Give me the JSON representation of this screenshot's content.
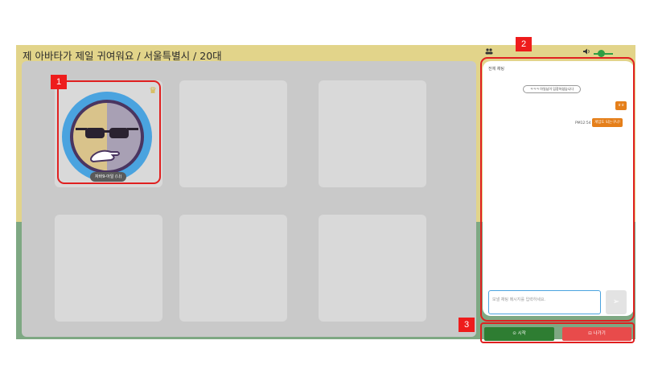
{
  "header": {
    "title": "제 아바타가 제일 귀여워요 / 서울특별시 / 20대",
    "people_icon": "people-icon",
    "volume_icon": "volume-icon"
  },
  "player": {
    "nametag": "자바9-아일 (나)",
    "crown_icon": "crown-icon"
  },
  "annotations": {
    "badge1": "1",
    "badge2": "2",
    "badge3": "3"
  },
  "chat": {
    "header": "전체 채팅",
    "system_message": "ㅋㅋㅋ 아일님이 입장하셨습니다",
    "messages": [
      {
        "text": "ㅎㅎ"
      },
      {
        "text": "게임도 되는구나!",
        "time": "PM12:54"
      }
    ],
    "input_placeholder": "보낼 채팅 메시지를 입력하세요.",
    "send_icon": "send-icon"
  },
  "buttons": {
    "start_label": "⊙ 시작",
    "leave_label": "⊡ 나가기"
  },
  "colors": {
    "band_top": "#e2d48a",
    "band_bottom": "#7ea883",
    "accent_orange": "#e57f1a",
    "start_green": "#2e7d32",
    "leave_red": "#e84b4b",
    "annotation_red": "#ee1c1c"
  }
}
